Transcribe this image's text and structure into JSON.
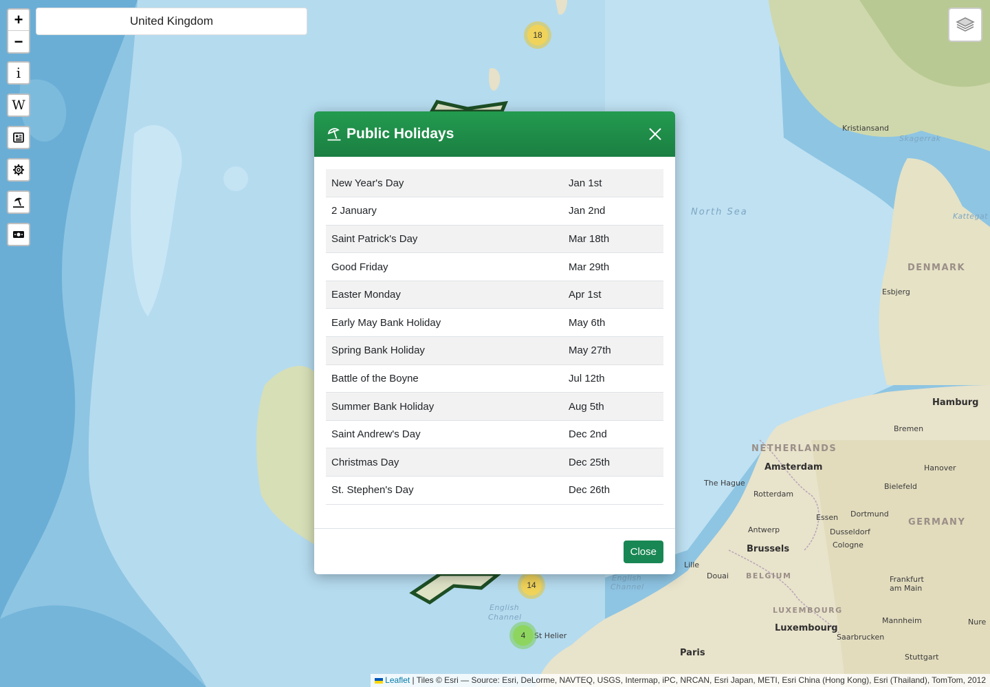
{
  "search": {
    "value": "United Kingdom"
  },
  "controls": {
    "zoom_in": "+",
    "zoom_out": "−",
    "icons": [
      "info-icon",
      "wikipedia-icon",
      "news-icon",
      "settings-icon",
      "beach-umbrella-icon",
      "money-icon",
      "layers-icon"
    ]
  },
  "map": {
    "labels": {
      "north_sea": "North Sea",
      "skagerrak": "Skagerrak",
      "kattegat": "Kattegat",
      "denmark": "DENMARK",
      "netherlands": "NETHERLANDS",
      "germany": "GERMANY",
      "belgium": "BELGIUM",
      "luxembourg_country": "LUXEMBOURG",
      "english_channel_1": "English",
      "english_channel_1b": "Channel",
      "english_channel_2": "English",
      "english_channel_2b": "Channel",
      "kristiansand": "Kristiansand",
      "esbjerg": "Esbjerg",
      "hamburg": "Hamburg",
      "bremen": "Bremen",
      "hanover": "Hanover",
      "amsterdam": "Amsterdam",
      "the_hague": "The Hague",
      "rotterdam": "Rotterdam",
      "bielefeld": "Bielefeld",
      "essen": "Essen",
      "dortmund": "Dortmund",
      "antwerp": "Antwerp",
      "dusseldorf": "Dusseldorf",
      "cologne": "Cologne",
      "brussels": "Brussels",
      "lille": "Lille",
      "douai": "Douai",
      "frankfurt": "Frankfurt",
      "frankfurt_b": "am Main",
      "luxembourg_city": "Luxembourg",
      "saarbrucken": "Saarbrucken",
      "mannheim": "Mannheim",
      "nuremberg": "Nure",
      "paris": "Paris",
      "stuttgart": "Stuttgart",
      "st_helier": "St Helier"
    },
    "clusters": [
      "18",
      "14",
      "4"
    ]
  },
  "modal": {
    "title": "Public Holidays",
    "holidays": [
      {
        "name": "New Year's Day",
        "date": "Jan 1st"
      },
      {
        "name": "2 January",
        "date": "Jan 2nd"
      },
      {
        "name": "Saint Patrick's Day",
        "date": "Mar 18th"
      },
      {
        "name": "Good Friday",
        "date": "Mar 29th"
      },
      {
        "name": "Easter Monday",
        "date": "Apr 1st"
      },
      {
        "name": "Early May Bank Holiday",
        "date": "May 6th"
      },
      {
        "name": "Spring Bank Holiday",
        "date": "May 27th"
      },
      {
        "name": "Battle of the Boyne",
        "date": "Jul 12th"
      },
      {
        "name": "Summer Bank Holiday",
        "date": "Aug 5th"
      },
      {
        "name": "Saint Andrew's Day",
        "date": "Dec 2nd"
      },
      {
        "name": "Christmas Day",
        "date": "Dec 25th"
      },
      {
        "name": "St. Stephen's Day",
        "date": "Dec 26th"
      }
    ],
    "close_button": "Close"
  },
  "attribution": {
    "leaflet": "Leaflet",
    "separator": " | ",
    "text": "Tiles © Esri — Source: Esri, DeLorme, NAVTEQ, USGS, Intermap, iPC, NRCAN, Esri Japan, METI, Esri China (Hong Kong), Esri (Thailand), TomTom, 2012"
  },
  "colors": {
    "header_green": "#1e8c48",
    "button_green": "#198754",
    "sea": "#b9dcee",
    "land": "#e9e4cf"
  }
}
